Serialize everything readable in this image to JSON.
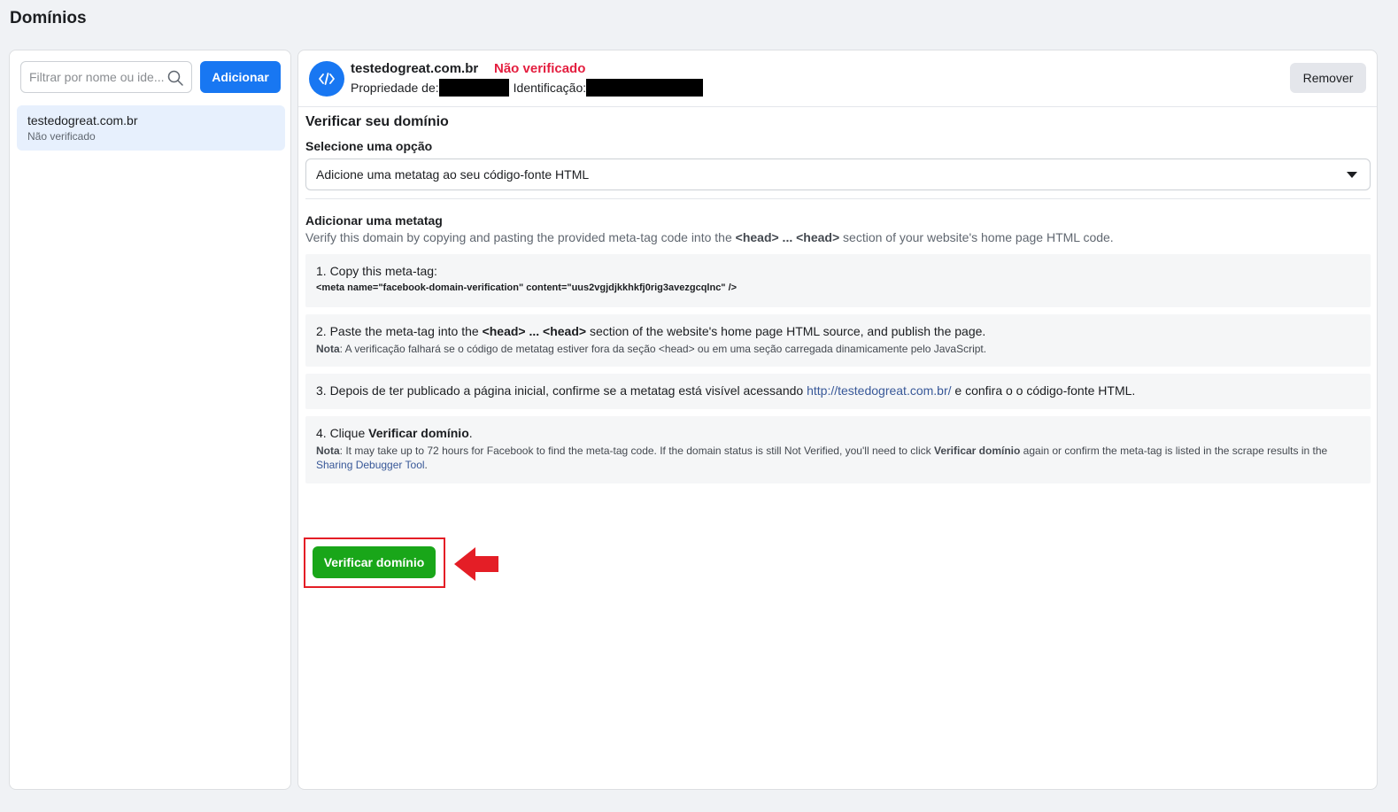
{
  "page": {
    "title": "Domínios"
  },
  "sidebar": {
    "search_placeholder": "Filtrar por nome ou ide...",
    "add_label": "Adicionar",
    "items": [
      {
        "name": "testedogreat.com.br",
        "status": "Não verificado"
      }
    ]
  },
  "header": {
    "domain": "testedogreat.com.br",
    "status": "Não verificado",
    "owner_label": "Propriedade de:",
    "id_label": "Identificação:",
    "remove_label": "Remover"
  },
  "verify": {
    "title": "Verificar seu domínio",
    "select_label": "Selecione uma opção",
    "selected_option": "Adicione uma metatag ao seu código-fonte HTML"
  },
  "metatag": {
    "title": "Adicionar uma metatag",
    "desc_pre": "Verify this domain by copying and pasting the provided meta-tag code into the ",
    "desc_bold": "<head> ... <head>",
    "desc_post": " section of your website's home page HTML code.",
    "steps": [
      {
        "text": "1. Copy this meta-tag:",
        "code": "<meta name=\"facebook-domain-verification\" content=\"uus2vgjdjkkhkfj0rig3avezgcqlnc\" />"
      },
      {
        "text_pre": "2. Paste the meta-tag into the ",
        "text_bold": "<head> ... <head>",
        "text_post": " section of the website's home page HTML source, and publish the page.",
        "note_label": "Nota",
        "note": ": A verificação falhará se o código de metatag estiver fora da seção <head> ou em uma seção carregada dinamicamente pelo JavaScript."
      },
      {
        "text_pre": "3. Depois de ter publicado a página inicial, confirme se a metatag está visível acessando ",
        "link": "http://testedogreat.com.br/",
        "text_post": " e confira o o código-fonte HTML."
      },
      {
        "text_pre": "4. Clique ",
        "text_bold": "Verificar domínio",
        "text_post": ".",
        "note_label": "Nota",
        "note_pre": ": It may take up to 72 hours for Facebook to find the meta-tag code. If the domain status is still Not Verified, you'll need to click ",
        "note_bold": "Verificar domínio",
        "note_mid": " again or confirm the meta-tag is listed in the scrape results in the ",
        "note_link": "Sharing Debugger Tool",
        "note_post": "."
      }
    ]
  },
  "action": {
    "verify_label": "Verificar domínio"
  },
  "colors": {
    "primary": "#1877f2",
    "success": "#19a619",
    "error": "#e41e3f",
    "highlight_box": "#e41e26"
  }
}
